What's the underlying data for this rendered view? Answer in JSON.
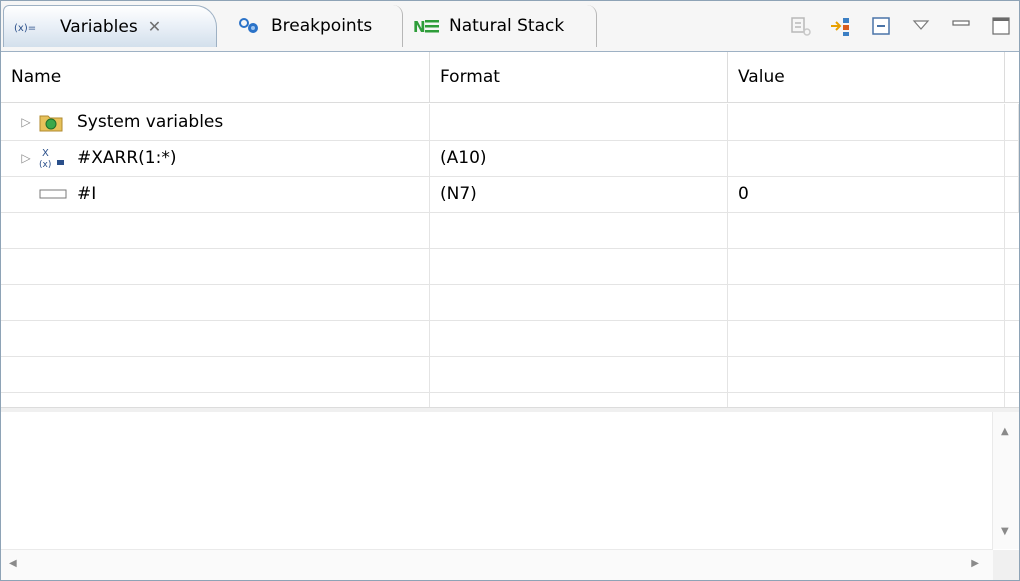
{
  "tabs": [
    {
      "label": "Variables",
      "icon": "variables-icon",
      "active": true
    },
    {
      "label": "Breakpoints",
      "icon": "breakpoints-icon",
      "active": false
    },
    {
      "label": "Natural Stack",
      "icon": "natural-stack-icon",
      "active": false
    }
  ],
  "toolbar": {
    "icons": [
      "show-type-names-icon",
      "add-watch-expression-icon",
      "collapse-all-icon",
      "view-menu-icon",
      "minimize-icon",
      "maximize-icon"
    ]
  },
  "table": {
    "columns": [
      "Name",
      "Format",
      "Value"
    ],
    "rows": [
      {
        "name": "System variables",
        "format": "",
        "value": "",
        "expandable": true,
        "icon": "folder-icon"
      },
      {
        "name": "#XARR(1:*)",
        "format": "(A10)",
        "value": "",
        "expandable": true,
        "icon": "array-variable-icon"
      },
      {
        "name": "#I",
        "format": "(N7)",
        "value": "0",
        "expandable": false,
        "icon": "scalar-variable-icon"
      }
    ]
  },
  "detail": {
    "text": ""
  },
  "colors": {
    "active_tab_border": "#9eb1c4",
    "folder_green": "#4caf50",
    "natural_green": "#2e9d3a",
    "breakpoint_blue": "#2a72c8"
  }
}
